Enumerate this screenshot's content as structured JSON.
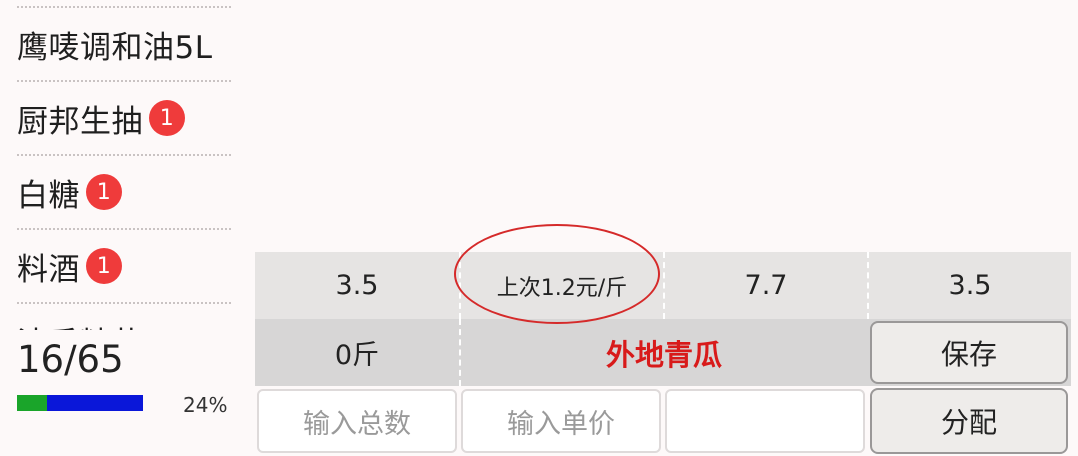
{
  "list": {
    "items": [
      {
        "name": "鹰唛调和油5L",
        "badge": "",
        "badge_color": "red"
      },
      {
        "name": "厨邦生抽",
        "badge": "1",
        "badge_color": "red"
      },
      {
        "name": "白糖",
        "badge": "1",
        "badge_color": "red"
      },
      {
        "name": "料酒",
        "badge": "1",
        "badge_color": "red"
      },
      {
        "name": "清香精盐",
        "badge": "",
        "badge_color": "green"
      }
    ]
  },
  "progress": {
    "count": "16/65",
    "percent_label": "24%",
    "fraction": 0.24,
    "done_color": "#1aa52a",
    "rest_color": "#0a17d9"
  },
  "grid": {
    "row1": [
      "3.5",
      "上次1.2元/斤",
      "7.7",
      "3.5"
    ],
    "row2": {
      "quantity": "0斤",
      "product_name": "外地青瓜",
      "save_label": "保存"
    },
    "row3": {
      "total_placeholder": "输入总数",
      "price_placeholder": "输入单价",
      "blank_value": "",
      "distribute_label": "分配"
    }
  },
  "colors": {
    "accent_red": "#d81a1a",
    "badge_red": "#ef3b3b",
    "badge_green": "#1d8a35"
  }
}
